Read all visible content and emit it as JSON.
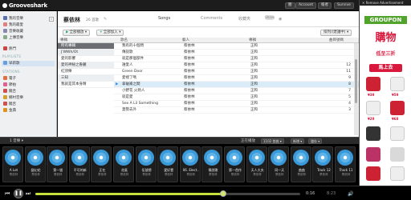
{
  "app": {
    "logo": "Grooveshark"
  },
  "topbar": {
    "buttons": [
      "簡",
      "Account",
      "帳者",
      "Survive"
    ]
  },
  "sidebar": {
    "items_top": [
      {
        "label": "我的音樂",
        "color": "#5b6fb0"
      },
      {
        "label": "我的最愛",
        "color": "#e08080"
      },
      {
        "label": "音樂收藏",
        "color": "#88a"
      },
      {
        "label": "上傳音樂",
        "color": "#8a8"
      }
    ],
    "item_mid": {
      "label": "熱門",
      "color": "#c44"
    },
    "playlists_header": "PLAYLISTS",
    "playlist": {
      "label": "早新歌",
      "color": "#6a9de0"
    },
    "stations_header": "STATIONS",
    "stations": [
      {
        "label": "電子",
        "color": "#e07040"
      },
      {
        "label": "節拍",
        "color": "#e06090"
      },
      {
        "label": "饒舌",
        "color": "#d05050"
      },
      {
        "label": "鄉村音樂",
        "color": "#d0a030"
      },
      {
        "label": "饒舌",
        "color": "#d05050"
      },
      {
        "label": "金典",
        "color": "#e09020"
      }
    ],
    "collapse": "«"
  },
  "page": {
    "title": "蔡依林",
    "count": "26 首歌",
    "tabs": [
      "Songs",
      "Comments",
      "收藏夾"
    ],
    "share": "Share"
  },
  "toolbar": {
    "add": "全部播放",
    "play_next": "全部加入",
    "sort": "排列/(建議中)"
  },
  "columns": {
    "filter": "專輯",
    "song": "歌名",
    "artist": "藝人",
    "album": "專輯",
    "num": "曲目號碼"
  },
  "filters": [
    {
      "label": "所有專輯",
      "sel": true
    },
    {
      "label": "J'WWh/Ot",
      "sel": false
    },
    {
      "label": "愛的影響",
      "sel": false
    },
    {
      "label": "愛的神秘之魯麗",
      "sel": false
    },
    {
      "label": "紅頂樂",
      "sel": false
    },
    {
      "label": "三知",
      "sel": false
    },
    {
      "label": "我就是其本身精",
      "sel": false
    }
  ],
  "songs": [
    {
      "name": "我有的十個問",
      "artist": "蔡依林",
      "album": "正和",
      "num": ""
    },
    {
      "name": "傳說歌",
      "artist": "蔡依林",
      "album": "正和",
      "num": ""
    },
    {
      "name": "就是那個部件",
      "artist": "蔡依林",
      "album": "正和",
      "num": ""
    },
    {
      "name": "誰愛人",
      "artist": "蔡依林",
      "album": "正和",
      "num": "12"
    },
    {
      "name": "Green Door",
      "artist": "蔡依林",
      "album": "正和",
      "num": "11"
    },
    {
      "name": "愛裡了嗎",
      "artist": "蔡依林",
      "album": "正和",
      "num": "9"
    },
    {
      "name": "拿破崙之間",
      "artist": "蔡依林",
      "album": "正和",
      "num": "8",
      "playing": true
    },
    {
      "name": "小野花 火熱人",
      "artist": "蔡依林",
      "album": "正和",
      "num": "7"
    },
    {
      "name": "就是愛",
      "artist": "蔡依林",
      "album": "正和",
      "num": "5"
    },
    {
      "name": "Sex A Lil Something",
      "artist": "蔡依林",
      "album": "正和",
      "num": "4"
    },
    {
      "name": "蓋勢去外",
      "artist": "蔡依林",
      "album": "正和",
      "num": "3"
    }
  ],
  "queue_bar": {
    "left_label": "1 音樂 ▾",
    "now_label": "正在播放",
    "count": "1102 首曲 ▾",
    "add": "新增 ▾",
    "save": "儲存 ▾"
  },
  "queue": [
    {
      "t1": "A Lot",
      "t2": "蔡依林"
    },
    {
      "t1": "變幻花",
      "t2": "蔡依林"
    },
    {
      "t1": "第一號",
      "t2": "蔡依林"
    },
    {
      "t1": "不可的新",
      "t2": "蔡依林"
    },
    {
      "t1": "正在",
      "t2": "蔡依林"
    },
    {
      "t1": "花區",
      "t2": "蔡依林"
    },
    {
      "t1": "伍號德",
      "t2": "蔡依林"
    },
    {
      "t1": "愛好壹",
      "t2": "蔡依林"
    },
    {
      "t1": "06. Elect..",
      "t2": "蔡依林"
    },
    {
      "t1": "傳說歌",
      "t2": "蔡依林"
    },
    {
      "t1": "第一首作",
      "t2": "蔡依林"
    },
    {
      "t1": "天人大夫",
      "t2": "蔡依林"
    },
    {
      "t1": "同一天",
      "t2": "蔡依林"
    },
    {
      "t1": "曲曲",
      "t2": "蔡依林"
    },
    {
      "t1": "Track 12",
      "t2": "蔡依林"
    },
    {
      "t1": "Track 11",
      "t2": "蔡依林"
    }
  ],
  "player": {
    "time_elapsed": "0:16",
    "time_total": "8:23",
    "progress": 0.71
  },
  "ad": {
    "remove": "Remove Advertisement",
    "logo": "GROUPON",
    "headline": "購物",
    "subline": "低至三折",
    "cta": "馬上去",
    "prices": [
      "¥39",
      "¥59",
      "¥29",
      "¥68"
    ]
  },
  "colors": {
    "accent": "#c6e03a",
    "selection": "#6b6f73",
    "playing_row": "#d9ecf7",
    "ad_red": "#d9183d"
  }
}
